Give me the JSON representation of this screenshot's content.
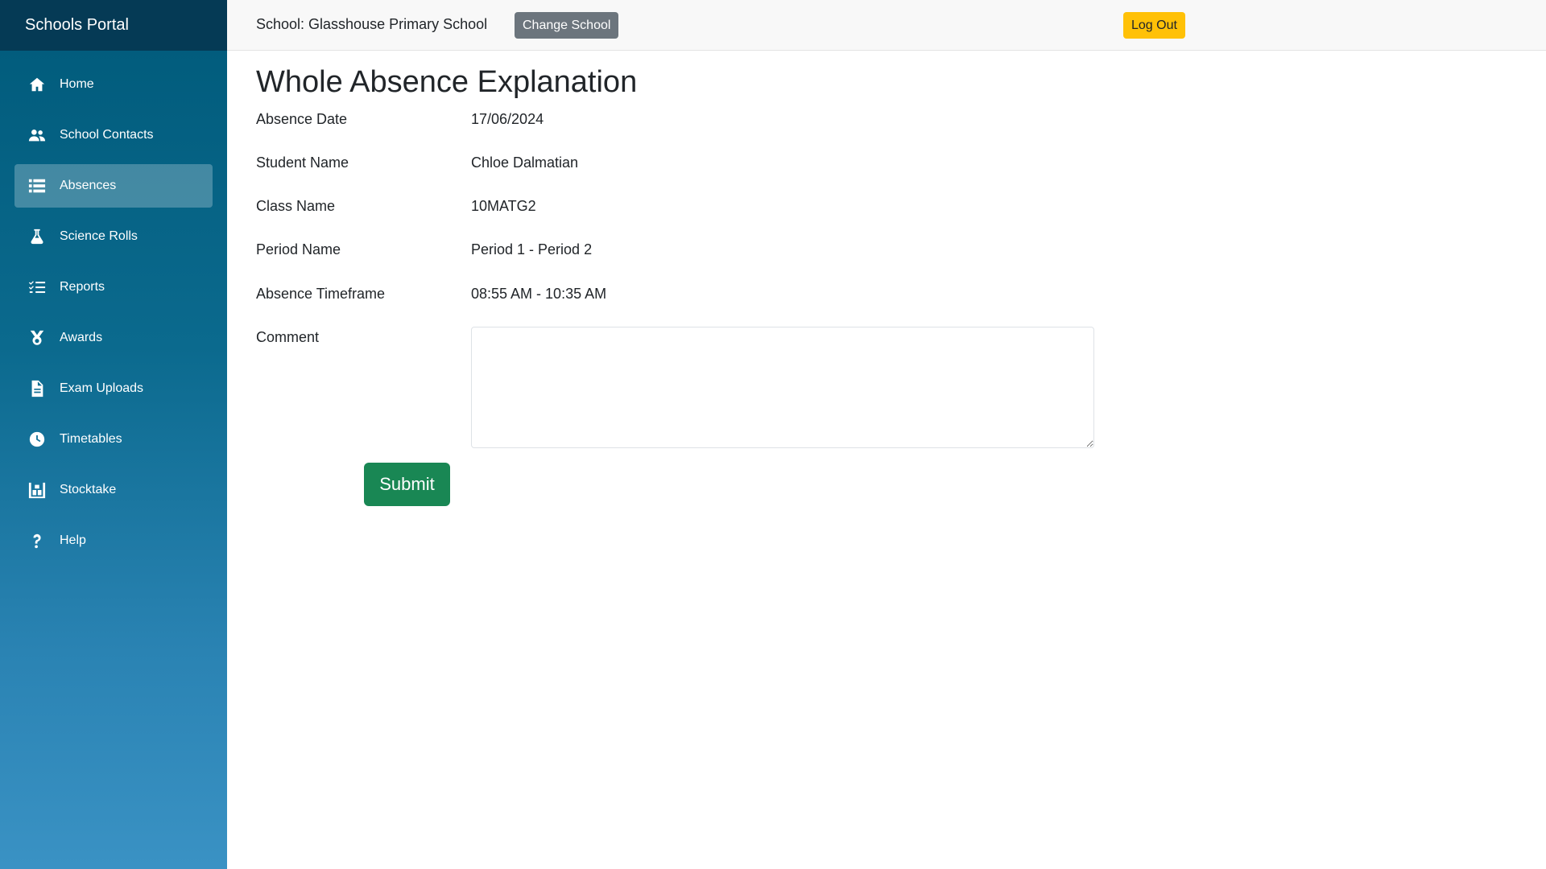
{
  "app": {
    "brand": "Schools Portal"
  },
  "topbar": {
    "school_label": "School: Glasshouse Primary School",
    "change_school_label": "Change School",
    "logout_label": "Log Out"
  },
  "sidebar": {
    "items": [
      {
        "label": "Home",
        "icon": "home-icon"
      },
      {
        "label": "School Contacts",
        "icon": "users-icon"
      },
      {
        "label": "Absences",
        "icon": "list-icon",
        "active": true
      },
      {
        "label": "Science Rolls",
        "icon": "flask-icon"
      },
      {
        "label": "Reports",
        "icon": "checklist-icon"
      },
      {
        "label": "Awards",
        "icon": "medal-icon"
      },
      {
        "label": "Exam Uploads",
        "icon": "file-icon"
      },
      {
        "label": "Timetables",
        "icon": "clock-icon"
      },
      {
        "label": "Stocktake",
        "icon": "warehouse-icon"
      },
      {
        "label": "Help",
        "icon": "question-icon"
      }
    ]
  },
  "page": {
    "title": "Whole Absence Explanation",
    "fields": [
      {
        "label": "Absence Date",
        "value": "17/06/2024"
      },
      {
        "label": "Student Name",
        "value": "Chloe Dalmatian"
      },
      {
        "label": "Class Name",
        "value": "10MATG2"
      },
      {
        "label": "Period Name",
        "value": "Period 1 - Period 2"
      },
      {
        "label": "Absence Timeframe",
        "value": "08:55 AM - 10:35 AM"
      }
    ],
    "comment_label": "Comment",
    "comment_value": "",
    "submit_label": "Submit"
  },
  "colors": {
    "brand_bar": "#053a55",
    "sidebar_top": "#005a7a",
    "sidebar_bottom": "#3a92c4",
    "submit": "#198754",
    "logout": "#ffc107",
    "change_school": "#6c757d"
  }
}
